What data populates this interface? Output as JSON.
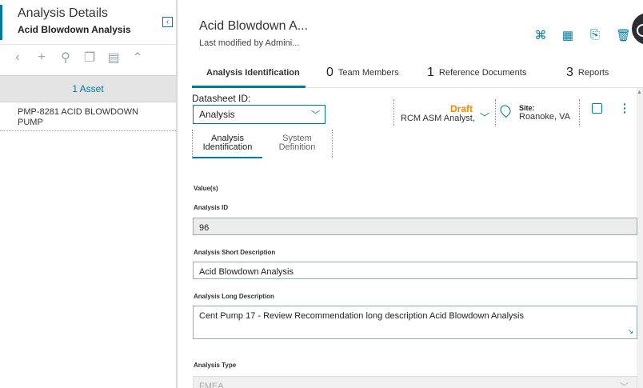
{
  "left_panel": {
    "title": "Analysis Details",
    "subtitle": "Acid Blowdown Analysis",
    "collapse_glyph": "‹",
    "toolbar_icons": [
      {
        "name": "back-icon",
        "glyph": "‹"
      },
      {
        "name": "add-icon",
        "glyph": "+"
      },
      {
        "name": "search-binoculars-icon",
        "glyph": "⚲"
      },
      {
        "name": "copy-icon",
        "glyph": "❐"
      },
      {
        "name": "paste-icon",
        "glyph": "▤"
      },
      {
        "name": "up-icon",
        "glyph": "⌃"
      }
    ],
    "asset_count": "1 Asset",
    "asset_item": "PMP-8281 ACID BLOWDOWN PUMP"
  },
  "header": {
    "title": "Acid Blowdown A...",
    "subtitle": "Last modified by Admini...",
    "icons": [
      {
        "name": "hierarchy-icon",
        "glyph": "⌘"
      },
      {
        "name": "report-icon",
        "glyph": "▦"
      },
      {
        "name": "export-icon",
        "glyph": "⎘"
      },
      {
        "name": "delete-icon",
        "glyph": "🗑"
      }
    ]
  },
  "tabs": [
    {
      "label": "Analysis Identification",
      "count": ""
    },
    {
      "label": "Team Members",
      "count": "0"
    },
    {
      "label": "Reference Documents",
      "count": "1"
    },
    {
      "label": "Reports",
      "count": "3"
    }
  ],
  "datasheet": {
    "label": "Datasheet ID:",
    "value": "Analysis",
    "state": "Draft",
    "state_owner": "RCM ASM Analyst,",
    "site_label": "Site:",
    "site_value": "Roanoke, VA"
  },
  "subtabs": [
    {
      "label1": "Analysis",
      "label2": "Identification"
    },
    {
      "label1": "System",
      "label2": "Definition"
    }
  ],
  "form": {
    "values_label": "Value(s)",
    "analysis_id_label": "Analysis ID",
    "analysis_id_value": "96",
    "short_desc_label": "Analysis Short Description",
    "short_desc_value": "Acid Blowdown Analysis",
    "long_desc_label": "Analysis Long Description",
    "long_desc_value": "Cent Pump 17 - Review Recommendation long description Acid Blowdown Analysis",
    "type_label": "Analysis Type",
    "type_value": "FMEA"
  },
  "colors": {
    "accent": "#00799e",
    "state_draft": "#f08a00"
  }
}
